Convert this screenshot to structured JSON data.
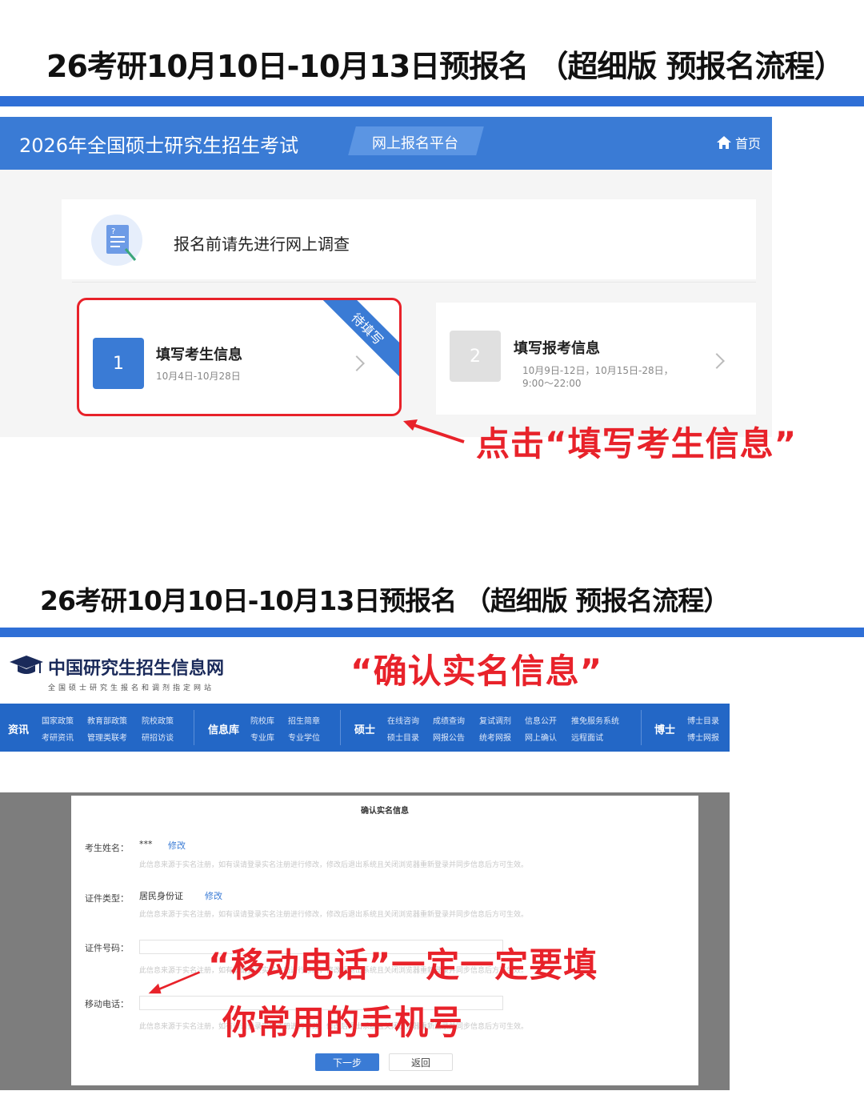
{
  "headline_1": "26考研10月10日-10月13日预报名 （超细版 预报名流程）",
  "headline_2": "26考研10月10日-10月13日预报名 （超细版 预报名流程）",
  "screenshot_1": {
    "header_title": "2026年全国硕士研究生招生考试",
    "platform_label": "网上报名平台",
    "home_label": "首页",
    "survey_text": "报名前请先进行网上调查",
    "step1": {
      "number": "1",
      "title": "填写考生信息",
      "date": "10月4日-10月28日",
      "ribbon": "待填写"
    },
    "step2": {
      "number": "2",
      "title": "填写报考信息",
      "date_line1": "10月9日-12日，10月15日-28日，",
      "date_line2": "9:00～22:00"
    },
    "callout": "点击“填写考生信息”"
  },
  "screenshot_2": {
    "site_name": "中国研究生招生信息网",
    "site_subtitle": "全国硕士研究生报名和调剂指定网站",
    "callout_top": "“确认实名信息”",
    "nav": {
      "group_news": {
        "head": "资讯",
        "links": [
          "国家政策",
          "教育部政策",
          "院校政策",
          "考研资讯",
          "管理类联考",
          "研招访谈"
        ]
      },
      "group_db": {
        "head": "信息库",
        "links": [
          "院校库",
          "招生简章",
          "专业库",
          "专业学位"
        ]
      },
      "group_master": {
        "head": "硕士",
        "links": [
          "在线咨询",
          "成绩查询",
          "复试调剂",
          "信息公开",
          "推免服务系统",
          "硕士目录",
          "网报公告",
          "统考网报",
          "网上确认",
          "远程面试"
        ]
      },
      "group_phd": {
        "head": "博士",
        "links": [
          "博士目录",
          "博士网报"
        ]
      }
    },
    "dialog": {
      "title": "确认实名信息",
      "name_label": "考生姓名：",
      "name_value": "***",
      "name_edit": "修改",
      "idtype_label": "证件类型：",
      "idtype_value": "居民身份证",
      "idtype_edit": "修改",
      "idnum_label": "证件号码：",
      "phone_label": "移动电话：",
      "hint": "此信息来源于实名注册，如有误请登录实名注册进行修改，修改后退出系统且关闭浏览器重新登录并同步信息后方可生效。",
      "next_button": "下一步",
      "back_button": "返回"
    },
    "callout_phone_1": "“移动电话”一定一定要填",
    "callout_phone_2": "你常用的手机号"
  },
  "colors": {
    "brand_blue": "#3a7bd5",
    "nav_blue": "#2367c6",
    "alert_red": "#e8222a"
  }
}
